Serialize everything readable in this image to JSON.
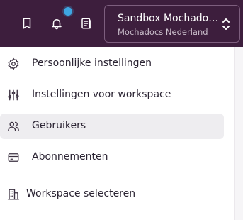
{
  "topbar": {
    "icons": [
      "bookmark-icon",
      "bell-icon",
      "newspaper-icon"
    ],
    "notification_color": "#3ea6e2",
    "background": "#3d1e3d"
  },
  "workspace": {
    "name": "Sandbox Mochado…",
    "organization": "Mochadocs Nederland",
    "toggle_icon": "chevron-up-down-icon"
  },
  "menu": {
    "items": [
      {
        "label": "Persoonlijke instellingen",
        "icon": "gear-icon"
      },
      {
        "label": "Instellingen voor workspace",
        "icon": "sliders-icon"
      },
      {
        "label": "Gebruikers",
        "icon": "users-icon"
      },
      {
        "label": "Abonnementen",
        "icon": "credit-card-icon"
      }
    ],
    "active_index": 2,
    "bottom_item": {
      "label": "Workspace selecteren",
      "icon": "building-icon"
    }
  }
}
